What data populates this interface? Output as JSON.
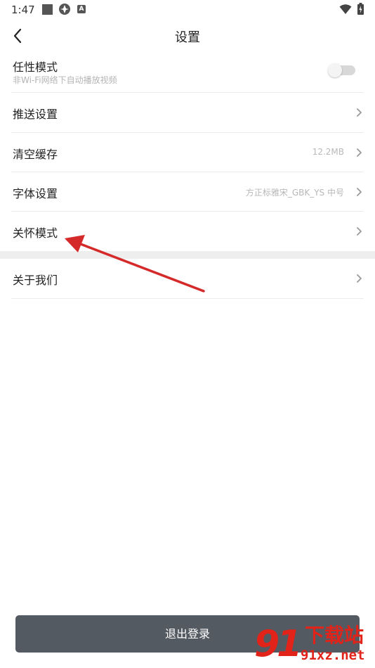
{
  "status_bar": {
    "time": "1:47",
    "notification_font_glyph": "A",
    "icons": [
      "square-notification-icon",
      "flower-icon",
      "font-icon",
      "wifi-icon",
      "battery-icon"
    ]
  },
  "header": {
    "title": "设置",
    "back_icon": "chevron-left-icon"
  },
  "settings": {
    "items": [
      {
        "label": "任性模式",
        "subtitle": "非Wi-Fi网络下自动播放视频",
        "control": "toggle",
        "toggle_on": false
      },
      {
        "label": "推送设置",
        "control": "chevron"
      },
      {
        "label": "清空缓存",
        "value": "12.2MB",
        "control": "chevron"
      },
      {
        "label": "字体设置",
        "value": "方正标雅宋_GBK_YS 中号",
        "control": "chevron"
      },
      {
        "label": "关怀模式",
        "control": "chevron"
      }
    ],
    "about": {
      "label": "关于我们",
      "control": "chevron"
    }
  },
  "logout": {
    "label": "退出登录"
  },
  "annotation": {
    "color": "#d42a2a",
    "points_to": "关怀模式"
  },
  "watermark": {
    "big": "91",
    "cn": "下载站",
    "url": "91xz.net",
    "color": "#e2231a"
  },
  "colors": {
    "logout_bg": "#545a61",
    "secondary_text": "#b8b8b8",
    "divider": "#ececec",
    "section_gap": "#eeeeee"
  }
}
